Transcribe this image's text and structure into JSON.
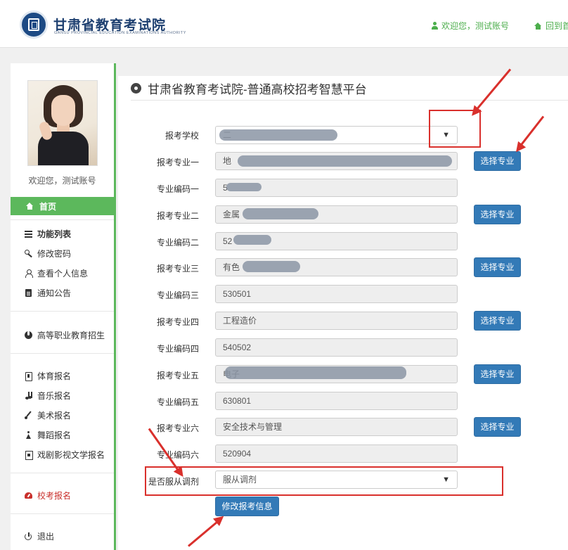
{
  "header": {
    "site_title": "甘肃省教育考试院",
    "site_subtitle": "GANSU PROVINCIAL EDUCATION EXAMINATIONS AUTHORITY",
    "welcome": "欢迎您，测试账号",
    "home_link": "回到首"
  },
  "sidebar": {
    "welcome": "欢迎您，测试账号",
    "home": "首页",
    "section_title": "功能列表",
    "items": [
      {
        "label": "修改密码",
        "icon": "key-icon"
      },
      {
        "label": "查看个人信息",
        "icon": "user-icon"
      },
      {
        "label": "通知公告",
        "icon": "document-icon"
      },
      {
        "label": "高等职业教育招生",
        "icon": "rebel-icon"
      },
      {
        "label": "体育报名",
        "icon": "file-icon"
      },
      {
        "label": "音乐报名",
        "icon": "music-icon"
      },
      {
        "label": "美术报名",
        "icon": "brush-icon"
      },
      {
        "label": "舞蹈报名",
        "icon": "dancer-icon"
      },
      {
        "label": "戏剧影视文学报名",
        "icon": "film-icon"
      },
      {
        "label": "校考报名",
        "icon": "dashboard-icon"
      },
      {
        "label": "退出",
        "icon": "power-icon"
      }
    ]
  },
  "main": {
    "title": "甘肃省教育考试院-普通高校招考智慧平台",
    "school_label": "报考学校",
    "school_value": "二",
    "select_major_label": "选择专业",
    "majors": [
      {
        "label": "报考专业一",
        "value": "地",
        "code_label": "专业编码一",
        "code": "5"
      },
      {
        "label": "报考专业二",
        "value": "金属",
        "code_label": "专业编码二",
        "code": "52"
      },
      {
        "label": "报考专业三",
        "value": "有色",
        "code_label": "专业编码三",
        "code": "530501"
      },
      {
        "label": "报考专业四",
        "value": "工程造价",
        "code_label": "专业编码四",
        "code": "540502"
      },
      {
        "label": "报考专业五",
        "value": "电子",
        "code_label": "专业编码五",
        "code": "630801"
      },
      {
        "label": "报考专业六",
        "value": "安全技术与管理",
        "code_label": "专业编码六",
        "code": "520904"
      }
    ],
    "adjust_label": "是否服从调剂",
    "adjust_value": "服从调剂",
    "submit_label": "修改报考信息"
  },
  "colors": {
    "accent_green": "#5cb85c",
    "button_blue": "#337ab7",
    "annotation_red": "#d9302c"
  }
}
